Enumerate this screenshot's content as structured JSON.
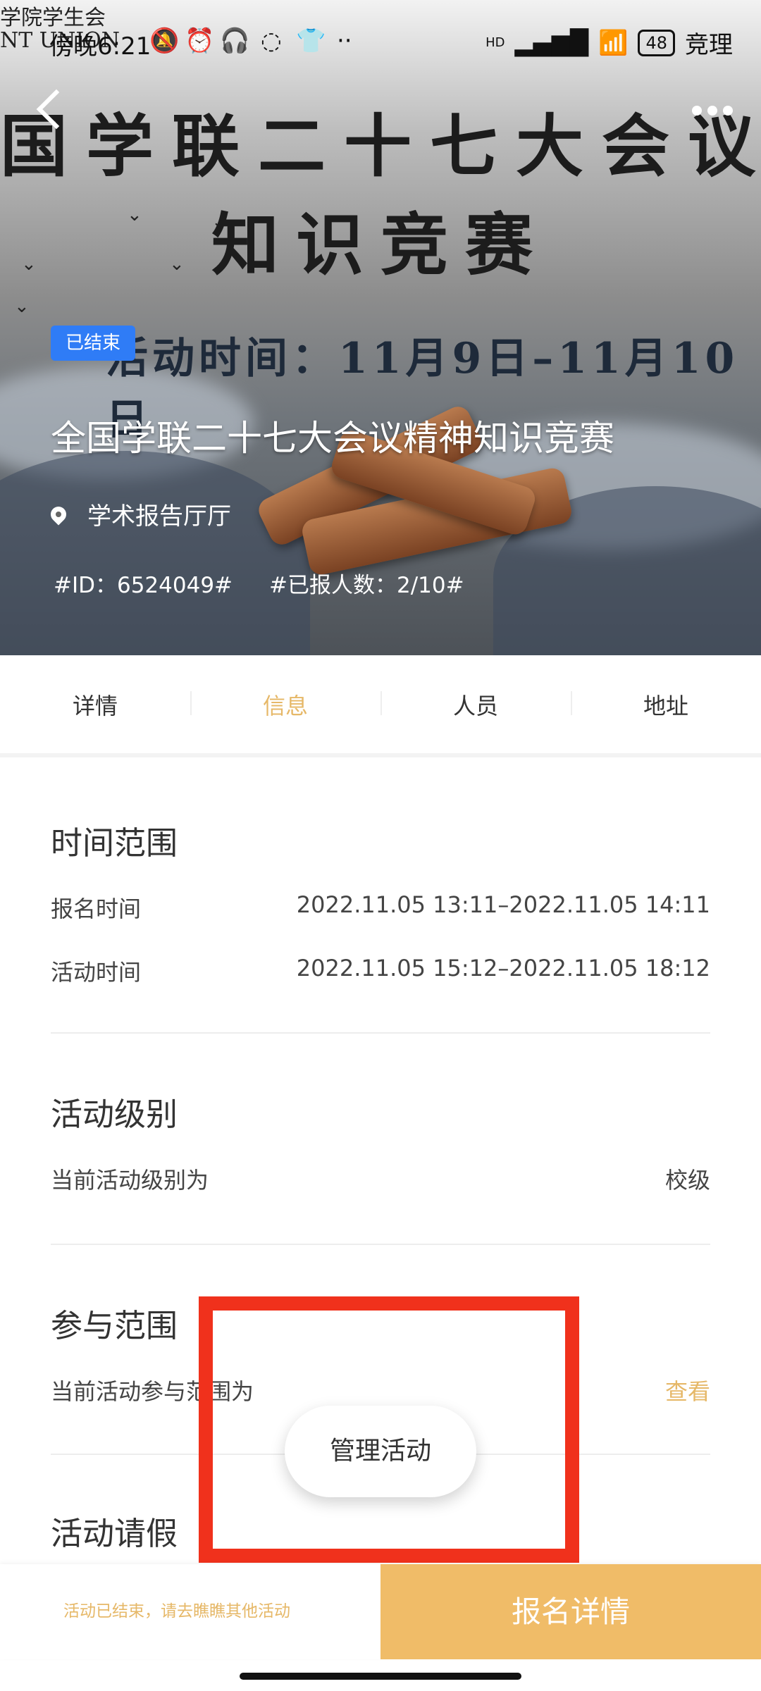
{
  "status_bar": {
    "time": "傍晚6:21",
    "logo_text_line1": "学院学生会",
    "logo_text_line2": "NT UNION",
    "network": "HD",
    "battery": "48",
    "right_text": "竞理"
  },
  "banner": {
    "line1": "国学联二十七大会议",
    "line2": "知识竞赛",
    "line3": "活动时间：11月9日–11月10日"
  },
  "activity": {
    "status_badge": "已结束",
    "title": "全国学联二十七大会议精神知识竞赛",
    "location": "学术报告厅厅",
    "id_text": "#ID：6524049#",
    "signup_count_text": "#已报人数：2/10#"
  },
  "tabs": [
    {
      "label": "详情"
    },
    {
      "label": "信息"
    },
    {
      "label": "人员"
    },
    {
      "label": "地址"
    }
  ],
  "sections": {
    "time_range": {
      "title": "时间范围",
      "signup_label": "报名时间",
      "signup_value": "2022.11.05 13:11–2022.11.05 14:11",
      "activity_label": "活动时间",
      "activity_value": "2022.11.05 15:12–2022.11.05 18:12"
    },
    "level": {
      "title": "活动级别",
      "label": "当前活动级别为",
      "value": "校级"
    },
    "scope": {
      "title": "参与范围",
      "label": "当前活动参与范围为",
      "link": "查看"
    },
    "leave": {
      "title": "活动请假"
    }
  },
  "fab": {
    "label": "管理活动"
  },
  "bottom_bar": {
    "note": "活动已结束，请去瞧瞧其他活动",
    "button": "报名详情"
  },
  "colors": {
    "accent": "#e6b868",
    "button_bg": "#f0bc68",
    "badge_blue": "#2f7cf6",
    "highlight_red": "#f0311c"
  }
}
